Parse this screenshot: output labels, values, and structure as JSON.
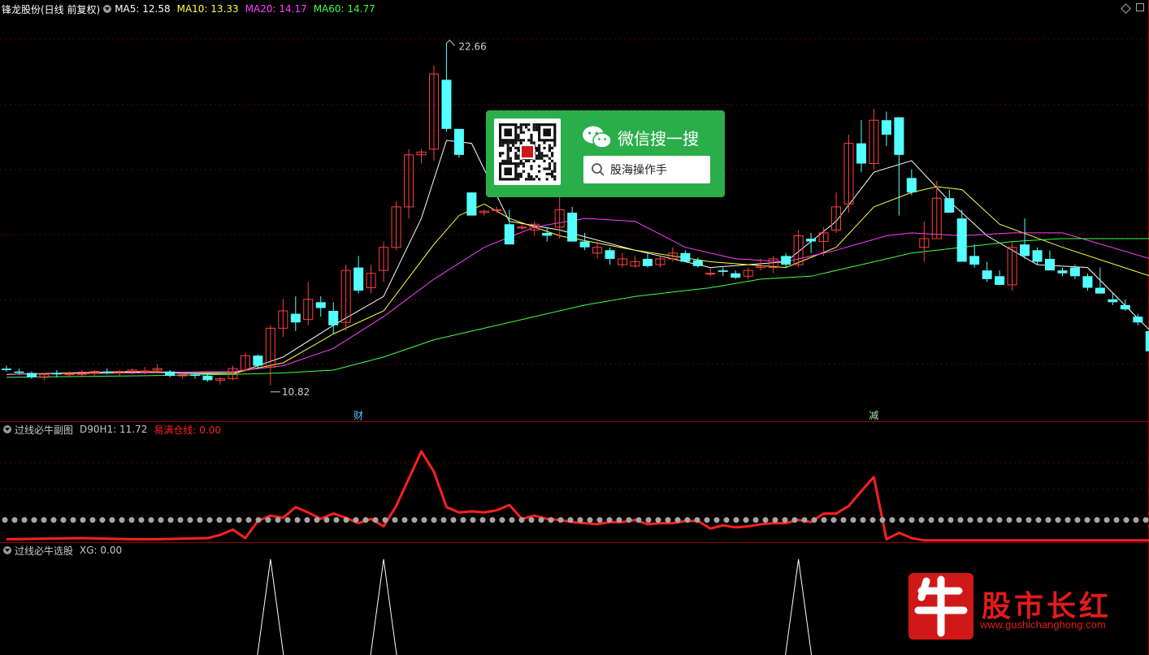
{
  "header": {
    "title": "锋龙股份(日线 前复权)",
    "ma5": "MA5: 12.58",
    "ma10": "MA10: 13.33",
    "ma20": "MA20: 14.17",
    "ma60": "MA60: 14.77"
  },
  "markers": {
    "high": "22.66",
    "low": "10.82",
    "fin": "财",
    "reduce": "减"
  },
  "sub1": {
    "title": "过线必牛副图",
    "d90": "D90H1: 11.72",
    "yimai": "易满仓线: 0.00"
  },
  "sub2": {
    "title": "过线必牛选股",
    "xg": "XG: 0.00"
  },
  "wechat": {
    "title": "微信搜一搜",
    "search": "股海操作手"
  },
  "logo": {
    "name": "股市长红",
    "url": "www.gushichanghong.com"
  },
  "colors": {
    "up": "#ff4040",
    "down": "#54ffff",
    "ma5": "#ffffff",
    "ma10": "#ffff40",
    "ma20": "#ff40ff",
    "ma60": "#40ff40",
    "redline": "#ff2020",
    "grid": "#6a0000"
  },
  "chart_data": [
    {
      "type": "candlestick",
      "title": "锋龙股份(日线 前复权)",
      "y_range": [
        10.0,
        23.6
      ],
      "annotations": [
        {
          "label": "22.66",
          "at_index": 35
        },
        {
          "label": "10.82",
          "at_index": 21
        },
        {
          "label": "财",
          "at_index": 28
        },
        {
          "label": "减",
          "at_index": 69
        }
      ],
      "ohlc": [
        [
          11.4,
          11.5,
          11.3,
          11.35
        ],
        [
          11.3,
          11.4,
          11.2,
          11.25
        ],
        [
          11.25,
          11.3,
          11.05,
          11.1
        ],
        [
          11.1,
          11.25,
          11.0,
          11.2
        ],
        [
          11.25,
          11.35,
          11.1,
          11.2
        ],
        [
          11.2,
          11.3,
          11.1,
          11.22
        ],
        [
          11.2,
          11.35,
          11.1,
          11.28
        ],
        [
          11.25,
          11.35,
          11.15,
          11.3
        ],
        [
          11.3,
          11.4,
          11.2,
          11.25
        ],
        [
          11.25,
          11.35,
          11.15,
          11.3
        ],
        [
          11.3,
          11.4,
          11.2,
          11.35
        ],
        [
          11.3,
          11.45,
          11.2,
          11.32
        ],
        [
          11.35,
          11.55,
          11.3,
          11.4
        ],
        [
          11.3,
          11.35,
          11.1,
          11.15
        ],
        [
          11.15,
          11.25,
          11.05,
          11.2
        ],
        [
          11.2,
          11.25,
          11.05,
          11.15
        ],
        [
          11.15,
          11.2,
          10.95,
          11.0
        ],
        [
          11.0,
          11.1,
          10.85,
          11.05
        ],
        [
          11.05,
          11.5,
          11.0,
          11.4
        ],
        [
          11.35,
          11.95,
          11.3,
          11.85
        ],
        [
          11.85,
          11.9,
          11.4,
          11.5
        ],
        [
          11.45,
          12.9,
          10.82,
          12.8
        ],
        [
          12.8,
          13.8,
          12.5,
          13.4
        ],
        [
          13.3,
          13.9,
          12.7,
          13.0
        ],
        [
          13.1,
          14.4,
          12.9,
          13.8
        ],
        [
          13.7,
          13.9,
          13.2,
          13.5
        ],
        [
          13.4,
          13.7,
          12.6,
          12.9
        ],
        [
          13.0,
          15.0,
          12.7,
          14.8
        ],
        [
          14.9,
          15.3,
          14.0,
          14.1
        ],
        [
          14.2,
          15.0,
          14.0,
          14.7
        ],
        [
          14.8,
          15.8,
          14.4,
          15.6
        ],
        [
          15.6,
          17.2,
          15.5,
          17.0
        ],
        [
          17.0,
          19.0,
          16.6,
          18.8
        ],
        [
          18.8,
          19.0,
          18.5,
          18.9
        ],
        [
          19.0,
          21.9,
          18.6,
          21.6
        ],
        [
          21.4,
          22.66,
          19.6,
          19.7
        ],
        [
          19.7,
          19.7,
          18.7,
          18.8
        ],
        [
          17.5,
          17.5,
          16.7,
          16.7
        ],
        [
          16.8,
          16.9,
          16.7,
          16.85
        ],
        [
          16.9,
          17.0,
          16.8,
          16.9
        ],
        [
          16.4,
          16.9,
          15.8,
          15.7
        ],
        [
          16.3,
          16.4,
          16.2,
          16.3
        ],
        [
          16.2,
          16.5,
          16.0,
          16.4
        ],
        [
          16.1,
          16.3,
          15.8,
          16.0
        ],
        [
          16.3,
          17.5,
          15.9,
          16.9
        ],
        [
          16.8,
          17.0,
          15.8,
          15.8
        ],
        [
          15.8,
          16.1,
          15.5,
          15.6
        ],
        [
          15.4,
          15.8,
          15.2,
          15.6
        ],
        [
          15.5,
          15.6,
          15.0,
          15.2
        ],
        [
          15.0,
          15.4,
          14.9,
          15.2
        ],
        [
          14.95,
          15.3,
          14.9,
          15.1
        ],
        [
          15.2,
          15.4,
          14.9,
          14.95
        ],
        [
          15.0,
          15.3,
          14.9,
          15.2
        ],
        [
          15.2,
          15.6,
          15.1,
          15.4
        ],
        [
          15.4,
          15.5,
          15.1,
          15.1
        ],
        [
          15.15,
          15.25,
          14.9,
          14.95
        ],
        [
          14.7,
          14.9,
          14.6,
          14.7
        ],
        [
          14.8,
          14.9,
          14.6,
          14.75
        ],
        [
          14.7,
          14.8,
          14.5,
          14.55
        ],
        [
          14.6,
          14.9,
          14.5,
          14.8
        ],
        [
          14.9,
          15.2,
          14.8,
          14.95
        ],
        [
          14.9,
          15.3,
          14.7,
          15.2
        ],
        [
          15.3,
          15.4,
          14.9,
          15.0
        ],
        [
          15.0,
          16.2,
          14.9,
          16.0
        ],
        [
          15.9,
          16.1,
          15.4,
          15.8
        ],
        [
          15.8,
          16.3,
          15.3,
          16.1
        ],
        [
          16.2,
          17.5,
          16.1,
          17.0
        ],
        [
          17.1,
          19.5,
          16.8,
          19.2
        ],
        [
          19.2,
          20.0,
          18.2,
          18.5
        ],
        [
          18.5,
          20.4,
          18.3,
          20.0
        ],
        [
          20.0,
          20.3,
          19.1,
          19.5
        ],
        [
          20.1,
          20.1,
          16.7,
          18.8
        ],
        [
          18.0,
          18.3,
          17.4,
          17.5
        ],
        [
          15.6,
          16.5,
          15.1,
          15.9
        ],
        [
          15.9,
          17.9,
          15.9,
          17.3
        ],
        [
          17.3,
          17.6,
          16.8,
          16.8
        ],
        [
          16.6,
          16.9,
          15.1,
          15.1
        ],
        [
          15.3,
          15.7,
          14.9,
          15.0
        ],
        [
          14.8,
          15.1,
          14.4,
          14.5
        ],
        [
          14.6,
          14.8,
          14.3,
          14.3
        ],
        [
          14.3,
          15.8,
          14.1,
          15.6
        ],
        [
          15.7,
          16.6,
          15.2,
          15.3
        ],
        [
          15.5,
          15.6,
          15.0,
          15.1
        ],
        [
          15.2,
          15.5,
          14.8,
          14.8
        ],
        [
          14.8,
          14.9,
          14.6,
          14.7
        ],
        [
          14.9,
          15.0,
          14.5,
          14.6
        ],
        [
          14.6,
          14.7,
          14.1,
          14.2
        ],
        [
          14.2,
          14.9,
          14.0,
          14.0
        ],
        [
          13.8,
          14.0,
          13.6,
          13.7
        ],
        [
          13.6,
          13.8,
          13.4,
          13.45
        ],
        [
          13.2,
          13.3,
          12.9,
          13.0
        ],
        [
          12.7,
          12.8,
          12.0,
          12.0
        ]
      ],
      "series": [
        {
          "name": "MA5",
          "x": [
            0,
            10,
            18,
            22,
            26,
            30,
            33,
            35,
            37,
            40,
            44,
            50,
            56,
            62,
            66,
            69,
            72,
            75,
            78,
            82,
            86,
            91
          ],
          "values": [
            11.2,
            11.28,
            11.2,
            11.8,
            12.9,
            13.9,
            16.6,
            19.3,
            19.2,
            16.5,
            16.2,
            15.5,
            14.9,
            15.1,
            16.5,
            18.2,
            18.6,
            17.2,
            16.0,
            15.0,
            14.9,
            12.7
          ]
        },
        {
          "name": "MA10",
          "x": [
            0,
            10,
            18,
            22,
            26,
            30,
            34,
            36,
            38,
            40,
            44,
            50,
            56,
            62,
            66,
            69,
            72,
            74,
            76,
            79,
            84,
            91
          ],
          "values": [
            11.2,
            11.3,
            11.25,
            11.6,
            12.6,
            13.4,
            15.7,
            16.7,
            17.1,
            16.6,
            16.0,
            15.5,
            15.1,
            14.9,
            15.6,
            17.0,
            17.5,
            17.7,
            17.6,
            16.4,
            15.6,
            14.6
          ]
        },
        {
          "name": "MA20",
          "x": [
            0,
            10,
            18,
            22,
            26,
            30,
            34,
            38,
            42,
            46,
            50,
            54,
            58,
            62,
            66,
            70,
            72,
            76,
            80,
            84,
            91
          ],
          "values": [
            11.2,
            11.25,
            11.3,
            11.5,
            12.1,
            13.2,
            14.5,
            15.6,
            16.3,
            16.6,
            16.5,
            15.6,
            15.2,
            15.1,
            15.5,
            16.0,
            16.1,
            16.0,
            16.1,
            16.1,
            15.2
          ]
        },
        {
          "name": "MA60",
          "x": [
            0,
            10,
            18,
            22,
            26,
            30,
            34,
            38,
            42,
            46,
            50,
            56,
            60,
            64,
            68,
            72,
            76,
            80,
            84,
            91
          ],
          "values": [
            11.1,
            11.15,
            11.2,
            11.25,
            11.35,
            11.8,
            12.4,
            12.8,
            13.2,
            13.6,
            13.9,
            14.2,
            14.5,
            14.6,
            15.0,
            15.4,
            15.6,
            15.8,
            15.9,
            15.9
          ]
        }
      ]
    },
    {
      "type": "line",
      "title": "过线必牛副图",
      "y_range": [
        0,
        100
      ],
      "series": [
        {
          "name": "D90H1",
          "x": [
            0,
            6,
            10,
            12,
            16,
            17,
            18,
            19,
            20,
            21,
            22,
            23,
            24,
            25,
            26,
            27,
            28,
            29,
            30,
            31,
            33,
            34,
            35,
            36,
            37,
            38,
            39,
            40,
            41,
            42,
            43,
            44,
            45,
            46,
            47,
            48,
            49,
            50,
            51,
            52,
            53,
            54,
            55,
            56,
            57,
            58,
            59,
            60,
            61,
            62,
            63,
            64,
            65,
            66,
            67,
            68,
            69,
            70,
            71,
            72,
            73,
            75,
            77,
            79,
            81,
            83,
            85,
            87,
            89,
            91
          ],
          "values": [
            2,
            3,
            2,
            2,
            3,
            6,
            11,
            3,
            19,
            24,
            22,
            32,
            27,
            21,
            26,
            22,
            17,
            21,
            14,
            33,
            84,
            65,
            32,
            27,
            28,
            27,
            29,
            34,
            21,
            24,
            21,
            20,
            18,
            17,
            16,
            18,
            18,
            20,
            16,
            17,
            17,
            19,
            19,
            12,
            15,
            13,
            14,
            16,
            17,
            17,
            20,
            18,
            26,
            26,
            33,
            47,
            60,
            2,
            8,
            3,
            1,
            1,
            1,
            1,
            1,
            1,
            1,
            1,
            1,
            1
          ]
        },
        {
          "name": "dots",
          "x": [
            0,
            91
          ],
          "values": [
            20,
            20
          ]
        }
      ]
    },
    {
      "type": "line",
      "title": "过线必牛选股",
      "y_range": [
        0,
        1
      ],
      "series": [
        {
          "name": "XG",
          "x": [
            21,
            30,
            63
          ],
          "values": [
            1,
            1,
            1
          ]
        }
      ]
    }
  ]
}
